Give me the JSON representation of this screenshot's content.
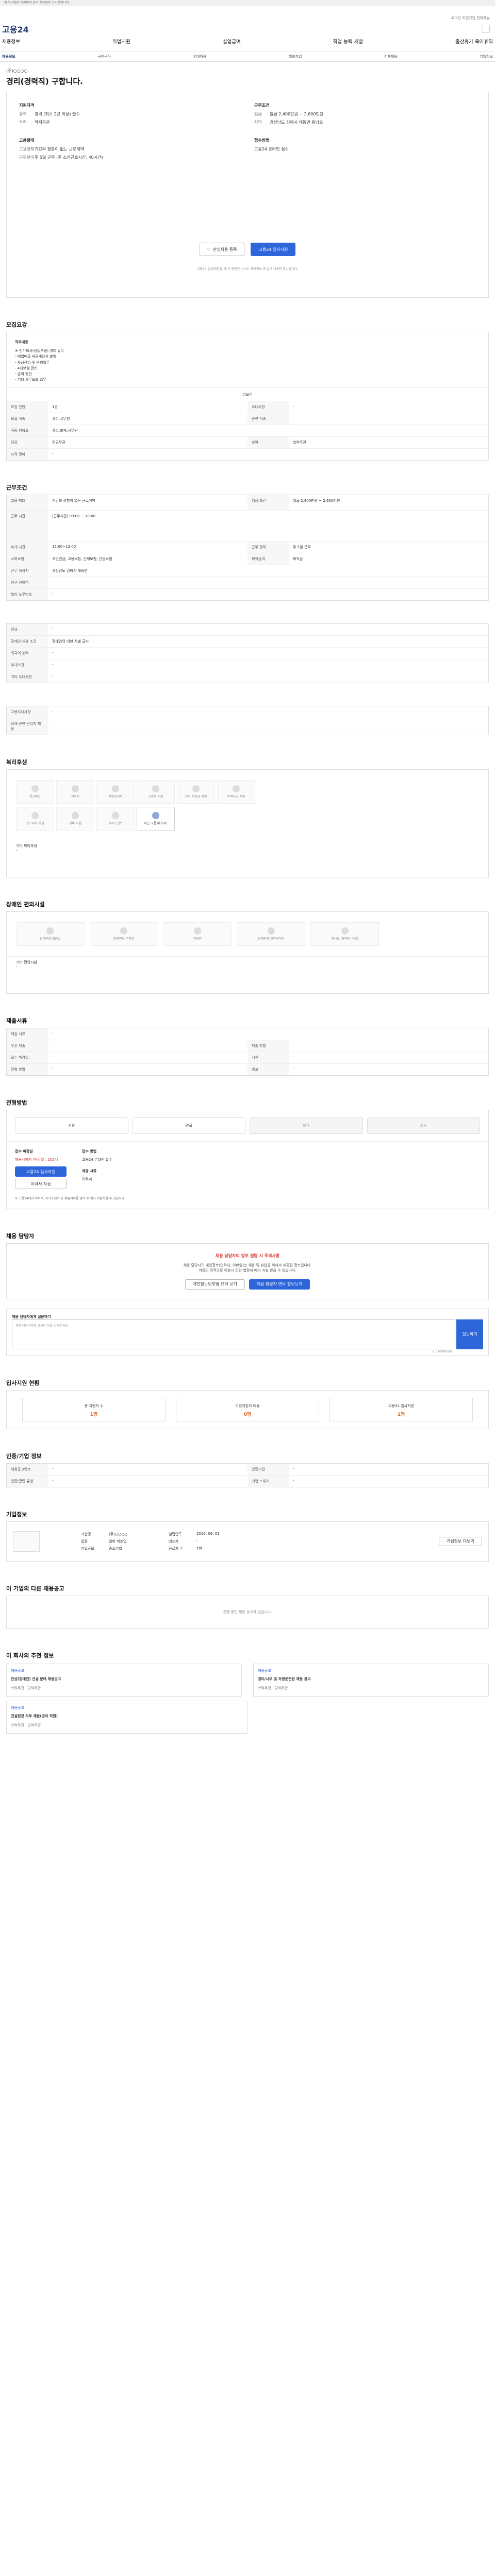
{
  "topbar": {
    "text": "이 누리집은 대한민국 공식 전자정부 누리집입니다."
  },
  "header": {
    "logo": "고용24",
    "links": "로그인   회원가입   전체메뉴",
    "nav": [
      "채용정보",
      "취업지원",
      "실업급여",
      "직업 능력 개발",
      "출산휴가 육아휴직"
    ]
  },
  "subnav": {
    "items": [
      "채용정보",
      "구인구직",
      "우대채용",
      "해외취업",
      "전체채용",
      "기업정보"
    ]
  },
  "job": {
    "company": "(주)○○○○",
    "title": "경리(경력직) 구합니다.",
    "left_head": "지원자격",
    "left": [
      {
        "k": "경력",
        "v": "경력 (최소 2년 이상) 필수"
      },
      {
        "k": "학력",
        "v": "학력무관"
      }
    ],
    "left_head2": "고용형태",
    "left2": [
      {
        "k": "고용형태",
        "v": "기간의 정함이 없는 근로계약"
      },
      {
        "k": "근무형태",
        "v": "주 5일 근무 (주 소정근로시간: 40시간)"
      }
    ],
    "right_head": "근무조건",
    "right": [
      {
        "k": "임금",
        "v": "월급 2,400만원 ~ 2,600만원"
      },
      {
        "k": "지역",
        "v": "경상남도 김해시 대동면 동남로"
      }
    ],
    "right_head2": "접수방법",
    "right2": [
      {
        "k": "",
        "v": "고용24 온라인 접수"
      }
    ],
    "btn_save": "관심채용 등록",
    "btn_apply": "고용24 입사지원",
    "sum_note": "고용24 입사지원 할 때 이 화면은 서비스 채용정보 중 일부 내용만 표시됩니다."
  },
  "sections": {
    "recruit": "모집요강",
    "work": "근무조건",
    "welfare": "복리후생",
    "disabled": "장애인 편의시설",
    "docs": "제출서류",
    "process": "전형방법",
    "hr": "채용 담당자",
    "stats": "입사지원 현황",
    "info": "인증/기업 정보",
    "ent": "기업정보",
    "other": "이 기업의 다른 채용공고",
    "similar": "이 회사의 추천 정보"
  },
  "recruit_grid": {
    "duty_title": "직무내용",
    "duty": [
      "※ 전기회사(정밀부품) 경리 업무",
      "- 매입매출 세금계산서 발행",
      "- 자금관리 및 은행업무",
      "- 4대보험 관리",
      "- 급여 정산",
      "- 기타 사무보조 업무"
    ],
    "more": "더보기",
    "rows": [
      {
        "k": "모집 인원",
        "v": "1명",
        "k2": "우대사항",
        "v2": "-"
      },
      {
        "k": "모집 직종",
        "v": "경리 사무원",
        "k2": "관련 직종",
        "v2": "-"
      },
      {
        "k": "직종 키워드",
        "v": "경리,회계,사무원",
        "k2": "",
        "v2": ""
      },
      {
        "k": "전공",
        "v": "전공무관",
        "k2": "학력",
        "v2": "학력무관"
      },
      {
        "k": "자격 면허",
        "v": "-",
        "k2": "",
        "v2": ""
      }
    ]
  },
  "work_grid": {
    "rows": [
      {
        "k": "고용 형태",
        "v": "기간의 정함이 없는 근로계약",
        "k2": "임금 조건",
        "v2": "월급 2,400만원 ~ 2,600만원"
      },
      {
        "k": "근무 시간",
        "v": "(근무시간) 09:00 ~ 18:00",
        "k2": "",
        "v2": ""
      },
      {
        "k": "휴게 시간",
        "v": "12:00~13:00",
        "k2": "근무 형태",
        "v2": "주 5일 근무"
      },
      {
        "k": "사회보험",
        "v": "국민연금, 고용보험, 산재보험, 건강보험",
        "k2": "퇴직급여",
        "v2": "퇴직금"
      },
      {
        "k": "근무 예정지",
        "v": "경상남도 김해시 대동면",
        "k2": "",
        "v2": ""
      },
      {
        "k": "인근 전철역",
        "v": "-",
        "k2": "",
        "v2": ""
      },
      {
        "k": "복리 노무번호",
        "v": "-",
        "k2": "",
        "v2": ""
      }
    ]
  },
  "etc_grid": {
    "rows": [
      {
        "k": "연금",
        "v": "-"
      },
      {
        "k": "장애인 채용 조건",
        "v": "장애인의 대한 차별 금지"
      },
      {
        "k": "외국어 능력",
        "v": "-"
      },
      {
        "k": "우대조건",
        "v": "-"
      },
      {
        "k": "기타 우대사항",
        "v": "-"
      }
    ]
  },
  "etc2_grid": {
    "rows": [
      {
        "k": "고용우대사항",
        "v": "-"
      },
      {
        "k": "장애 관련 관리자 채용",
        "v": "-"
      }
    ]
  },
  "welfare_icons": [
    "통근버스",
    "기숙사",
    "차량유지비",
    "교육비 지원",
    "자녀 학자금 지원",
    "주택자금 지원",
    "경조사비 지원",
    "식비 지원",
    "복지포인트",
    "야근 교통비(초과)"
  ],
  "welfare_note": {
    "k": "기타 복리후생",
    "v": "-"
  },
  "disabled_icons": [
    "장애인용 화장실",
    "장애인용 주차장",
    "자동문",
    "장애인용 엘리베이터",
    "경사로 (휠체어 이동)"
  ],
  "disabled_note": {
    "k": "기타 편의시설",
    "v": "-"
  },
  "docs_grid": {
    "rows": [
      {
        "k": "제출 서류",
        "v": "-",
        "k2": "",
        "v2": ""
      },
      {
        "k": "우선 제출",
        "v": "-",
        "k2": "제출 방법",
        "v2": "-"
      },
      {
        "k": "접수 마감일",
        "v": "-",
        "k2": "서류",
        "v2": "-"
      },
      {
        "k": "전형 방법",
        "v": "-",
        "k2": "비고",
        "v2": "-"
      }
    ]
  },
  "process_steps": [
    "서류",
    "면접",
    "합격",
    "최종"
  ],
  "apply": {
    "col1_head": "접수 마감일",
    "col1_v": "채용시까지 (마감일 : 2024)",
    "btn_apply": "고용24 입사지원",
    "btn_other": "이력서 작성",
    "col2_head": "접수 방법",
    "col2_v": "고용24 온라인 접수",
    "col3_head": "제출 서류",
    "col3_v": "이력서",
    "notice": "※ 고용24에서 이력서, 자기소개서 등 제출서류를 입력 후 입사 지원하실 수 있습니다."
  },
  "hr": {
    "warn": "채용 담당자의 정보 열람 시 주의사항",
    "line1": "채용 담당자의 개인정보(연락처, 이메일)는 채용 및 취업을 위해서 제공된 정보입니다.",
    "line2": "이외의 목적으로 이용시 관련 법령에 따라 처벌 받을 수 있습니다.",
    "btn1": "개인정보보호법 요약 보기",
    "btn2": "채용 담당자 연락 정보보기"
  },
  "qna": {
    "title": "채용 담당자에게 질문하기",
    "placeholder": "채용 담당자에게 궁금한 점을 남겨주세요.",
    "count": "0 / 1000byte",
    "btn": "질문하기"
  },
  "stats": [
    {
      "label": "총 지원자 수",
      "v": "1명"
    },
    {
      "label": "여성지원자 비율",
      "v": "0명"
    },
    {
      "label": "고용24 입사지원",
      "v": "1명"
    }
  ],
  "info_grid": {
    "rows": [
      {
        "k": "채용공고번호",
        "v": "-",
        "k2": "인증기업",
        "v2": "-"
      },
      {
        "k": "인증/관련 유형",
        "v": "-",
        "k2": "기업 소재지",
        "v2": "-"
      }
    ]
  },
  "ent": {
    "k1": "기업명",
    "v1": "(주)○○○○",
    "k2": "설립연도",
    "v2": "2016. 06. 01",
    "k3": "업종",
    "v3": "일반 제조업",
    "k4": "대표자",
    "v4": "-",
    "k5": "기업규모",
    "v5": "중소기업",
    "k6": "근로자 수",
    "v6": "7명",
    "btn": "기업정보 더보기"
  },
  "other_empty": "진행 중인 채용 공고가 없습니다.",
  "cards": [
    {
      "tag": "채용공고",
      "title": "인성(장애인) 건설 분야 채용공고",
      "meta": "학력무관 · 경력무관"
    },
    {
      "tag": "채용공고",
      "title": "경리/사무 및 차량운전원 채용 공고",
      "meta": "학력무관 · 경력무관"
    },
    {
      "tag": "채용공고",
      "title": "건설현장 사무 채용(경리 직원)",
      "meta": "학력무관 · 경력무관"
    }
  ]
}
